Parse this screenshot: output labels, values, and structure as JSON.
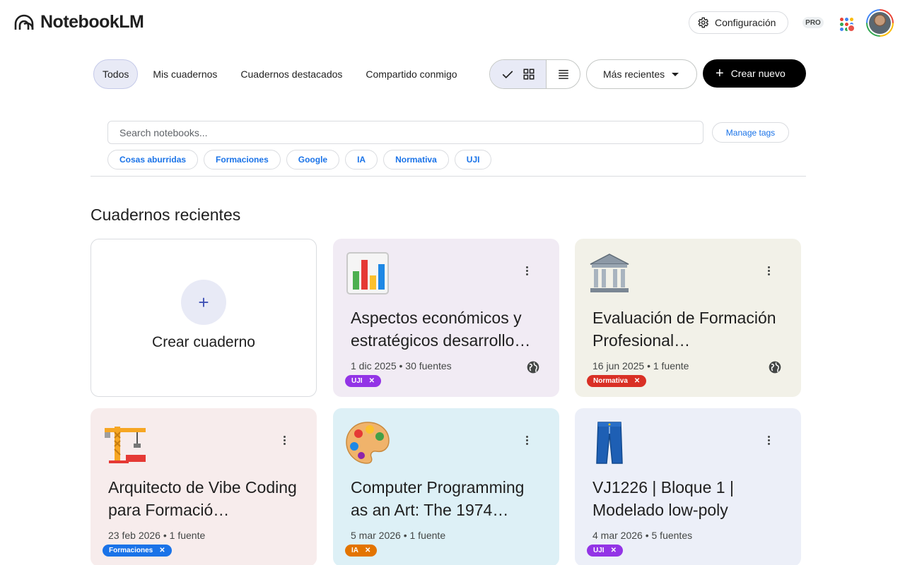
{
  "app": {
    "title": "NotebookLM",
    "settings_label": "Configuración",
    "pro_badge": "PRO"
  },
  "filters": {
    "tabs": [
      {
        "label": "Todos",
        "active": true
      },
      {
        "label": "Mis cuadernos",
        "active": false
      },
      {
        "label": "Cuadernos destacados",
        "active": false
      },
      {
        "label": "Compartido conmigo",
        "active": false
      }
    ],
    "sort_label": "Más recientes",
    "create_label": "Crear nuevo"
  },
  "search": {
    "placeholder": "Search notebooks...",
    "manage_tags_label": "Manage tags"
  },
  "tags": [
    "Cosas aburridas",
    "Formaciones",
    "Google",
    "IA",
    "Normativa",
    "UJI"
  ],
  "section": {
    "title": "Cuadernos recientes"
  },
  "new_notebook": {
    "label": "Crear cuaderno",
    "plus": "+"
  },
  "notebooks": [
    {
      "title": "Aspectos económicos y estratégicos desarrollo…",
      "meta": "1 dic 2025 • 30 fuentes",
      "tag": "UJI",
      "tag_color": "#9334e6",
      "bg": "#f1ebf4",
      "icon": "bar-chart-icon",
      "shared": true
    },
    {
      "title": "Evaluación de Formación Profesional…",
      "meta": "16 jun 2025 • 1 fuente",
      "tag": "Normativa",
      "tag_color": "#d93025",
      "bg": "#f2f1e8",
      "icon": "classical-building-icon",
      "shared": true
    },
    {
      "title": "Arquitecto de Vibe Coding para Formació…",
      "meta": "23 feb 2026 • 1 fuente",
      "tag": "Formaciones",
      "tag_color": "#1a73e8",
      "bg": "#f7ecec",
      "icon": "construction-crane-icon",
      "shared": false
    },
    {
      "title": "Computer Programming as an Art: The 1974…",
      "meta": "5 mar 2026 • 1 fuente",
      "tag": "IA",
      "tag_color": "#e37400",
      "bg": "#ddf0f6",
      "icon": "artist-palette-icon",
      "shared": false
    },
    {
      "title": "VJ1226 | Bloque 1 | Modelado low-poly",
      "meta": "4 mar 2026 • 5 fuentes",
      "tag": "UJI",
      "tag_color": "#9334e6",
      "bg": "#eceff8",
      "icon": "jeans-icon",
      "shared": false
    }
  ],
  "colors": {
    "accent": "#1a73e8",
    "primary_button": "#000000",
    "selected_bg": "#e8eaf6"
  }
}
